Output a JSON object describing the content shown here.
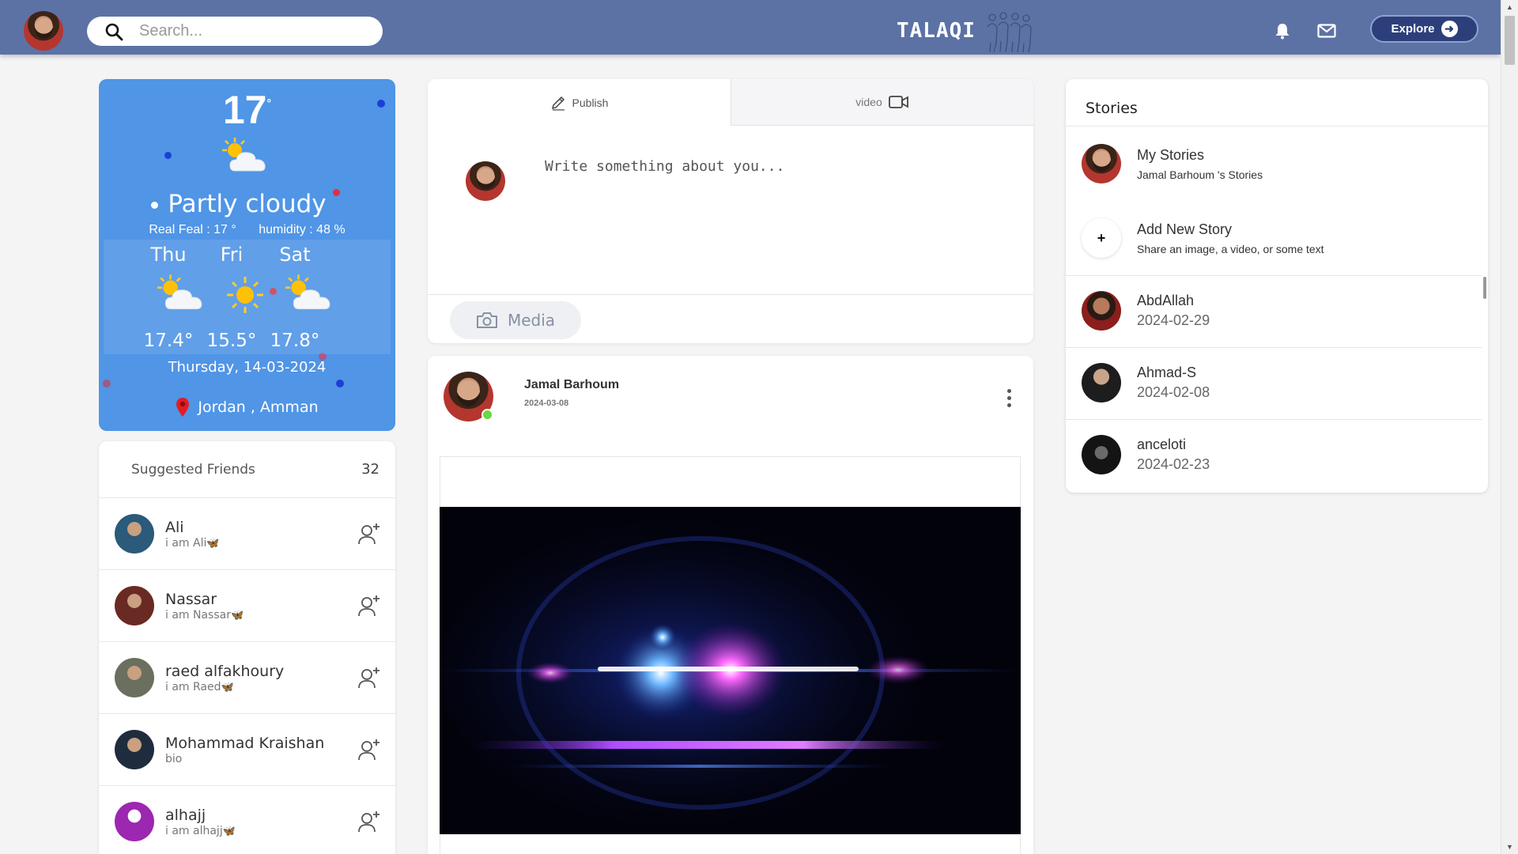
{
  "header": {
    "search_placeholder": "Search...",
    "brand": "TALAQI",
    "explore_label": "Explore"
  },
  "weather": {
    "temp": "17",
    "temp_unit": "°",
    "condition": "Partly cloudy",
    "real_feel": "Real Feal : 17 °",
    "humidity": "humidity : 48 %",
    "forecast": [
      {
        "day": "Thu",
        "temp": "17.4°",
        "icon": "partly-cloudy-icon"
      },
      {
        "day": "Fri",
        "temp": "15.5°",
        "icon": "sunny-icon"
      },
      {
        "day": "Sat",
        "temp": "17.8°",
        "icon": "partly-cloudy-icon"
      }
    ],
    "date": "Thursday, 14-03-2024",
    "location": "Jordan , Amman"
  },
  "suggested": {
    "title": "Suggested Friends",
    "count": "32",
    "items": [
      {
        "name": "Ali",
        "bio": "i am Ali",
        "emoji": "🦋",
        "color": "#2b5a7a"
      },
      {
        "name": "Nassar",
        "bio": "i am Nassar",
        "emoji": "🦋",
        "color": "#6a2a24"
      },
      {
        "name": "raed alfakhoury",
        "bio": "i am Raed",
        "emoji": "🦋",
        "color": "#6b6f5f"
      },
      {
        "name": "Mohammad Kraishan",
        "bio": "bio",
        "emoji": "",
        "color": "#1f2c3e"
      },
      {
        "name": "alhajj",
        "bio": "i am alhajj",
        "emoji": "🦋",
        "color": "#9c27b0"
      }
    ]
  },
  "composer": {
    "tab_publish": "Publish",
    "tab_video": "video",
    "placeholder": "Write something about you...",
    "media_label": "Media"
  },
  "post": {
    "author": "Jamal Barhoum",
    "date": "2024-03-08"
  },
  "stories": {
    "title": "Stories",
    "my_title": "My Stories",
    "my_sub": "Jamal Barhoum 's Stories",
    "add_title": "Add New Story",
    "add_sub": "Share an image, a video, or some text",
    "items": [
      {
        "name": "AbdAllah",
        "date": "2024-02-29"
      },
      {
        "name": "Ahmad-S",
        "date": "2024-02-08"
      },
      {
        "name": "anceloti",
        "date": "2024-02-23"
      }
    ]
  },
  "colors": {
    "topbar": "#5c72a5",
    "weather_bg": "#5095e6",
    "explore_bg": "#2d3f7b",
    "online": "#6cd640"
  }
}
